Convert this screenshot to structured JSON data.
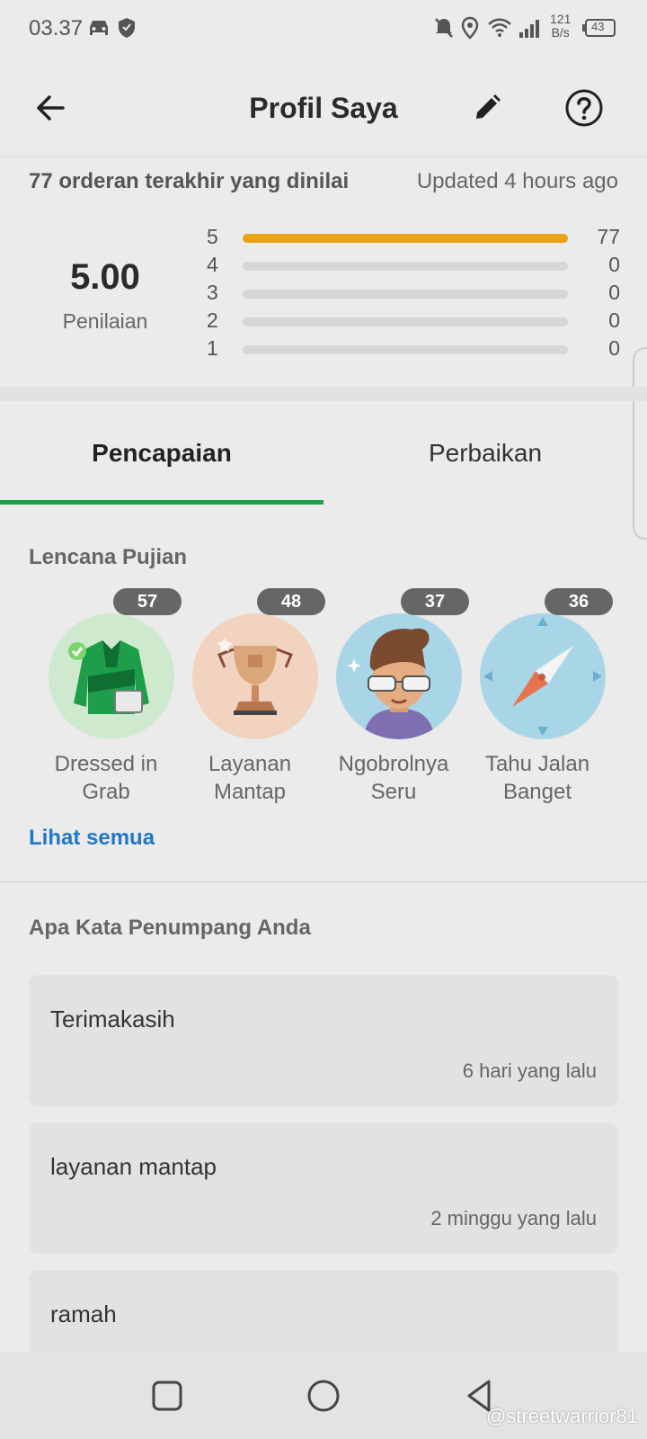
{
  "status_bar": {
    "time": "03.37",
    "net_speed_top": "121",
    "net_speed_bottom": "B/s",
    "battery": "43"
  },
  "app_bar": {
    "title": "Profil Saya"
  },
  "rating": {
    "heading": "77 orderan terakhir yang dinilai",
    "updated": "Updated 4 hours ago",
    "score": "5.00",
    "score_label": "Penilaian",
    "rows": [
      {
        "star": "5",
        "count": "77",
        "fraction": 1.0
      },
      {
        "star": "4",
        "count": "0",
        "fraction": 0
      },
      {
        "star": "3",
        "count": "0",
        "fraction": 0
      },
      {
        "star": "2",
        "count": "0",
        "fraction": 0
      },
      {
        "star": "1",
        "count": "0",
        "fraction": 0
      }
    ],
    "bar_color": "#e8a317"
  },
  "tabs": [
    {
      "label": "Pencapaian",
      "active": true
    },
    {
      "label": "Perbaikan",
      "active": false
    }
  ],
  "badges": {
    "title": "Lencana Pujian",
    "items": [
      {
        "count": "57",
        "name_line1": "Dressed in",
        "name_line2": "Grab",
        "icon": "jacket-icon"
      },
      {
        "count": "48",
        "name_line1": "Layanan",
        "name_line2": "Mantap",
        "icon": "trophy-icon"
      },
      {
        "count": "37",
        "name_line1": "Ngobrolnya",
        "name_line2": "Seru",
        "icon": "chatty-person-icon"
      },
      {
        "count": "36",
        "name_line1": "Tahu Jalan",
        "name_line2": "Banget",
        "icon": "compass-icon"
      }
    ],
    "see_all": "Lihat semua"
  },
  "reviews": {
    "title": "Apa Kata Penumpang Anda",
    "items": [
      {
        "text": "Terimakasih",
        "when": "6 hari yang lalu"
      },
      {
        "text": "layanan mantap",
        "when": "2 minggu yang lalu"
      },
      {
        "text": "ramah",
        "when": ""
      }
    ]
  },
  "watermark": "@streetwarrior81"
}
